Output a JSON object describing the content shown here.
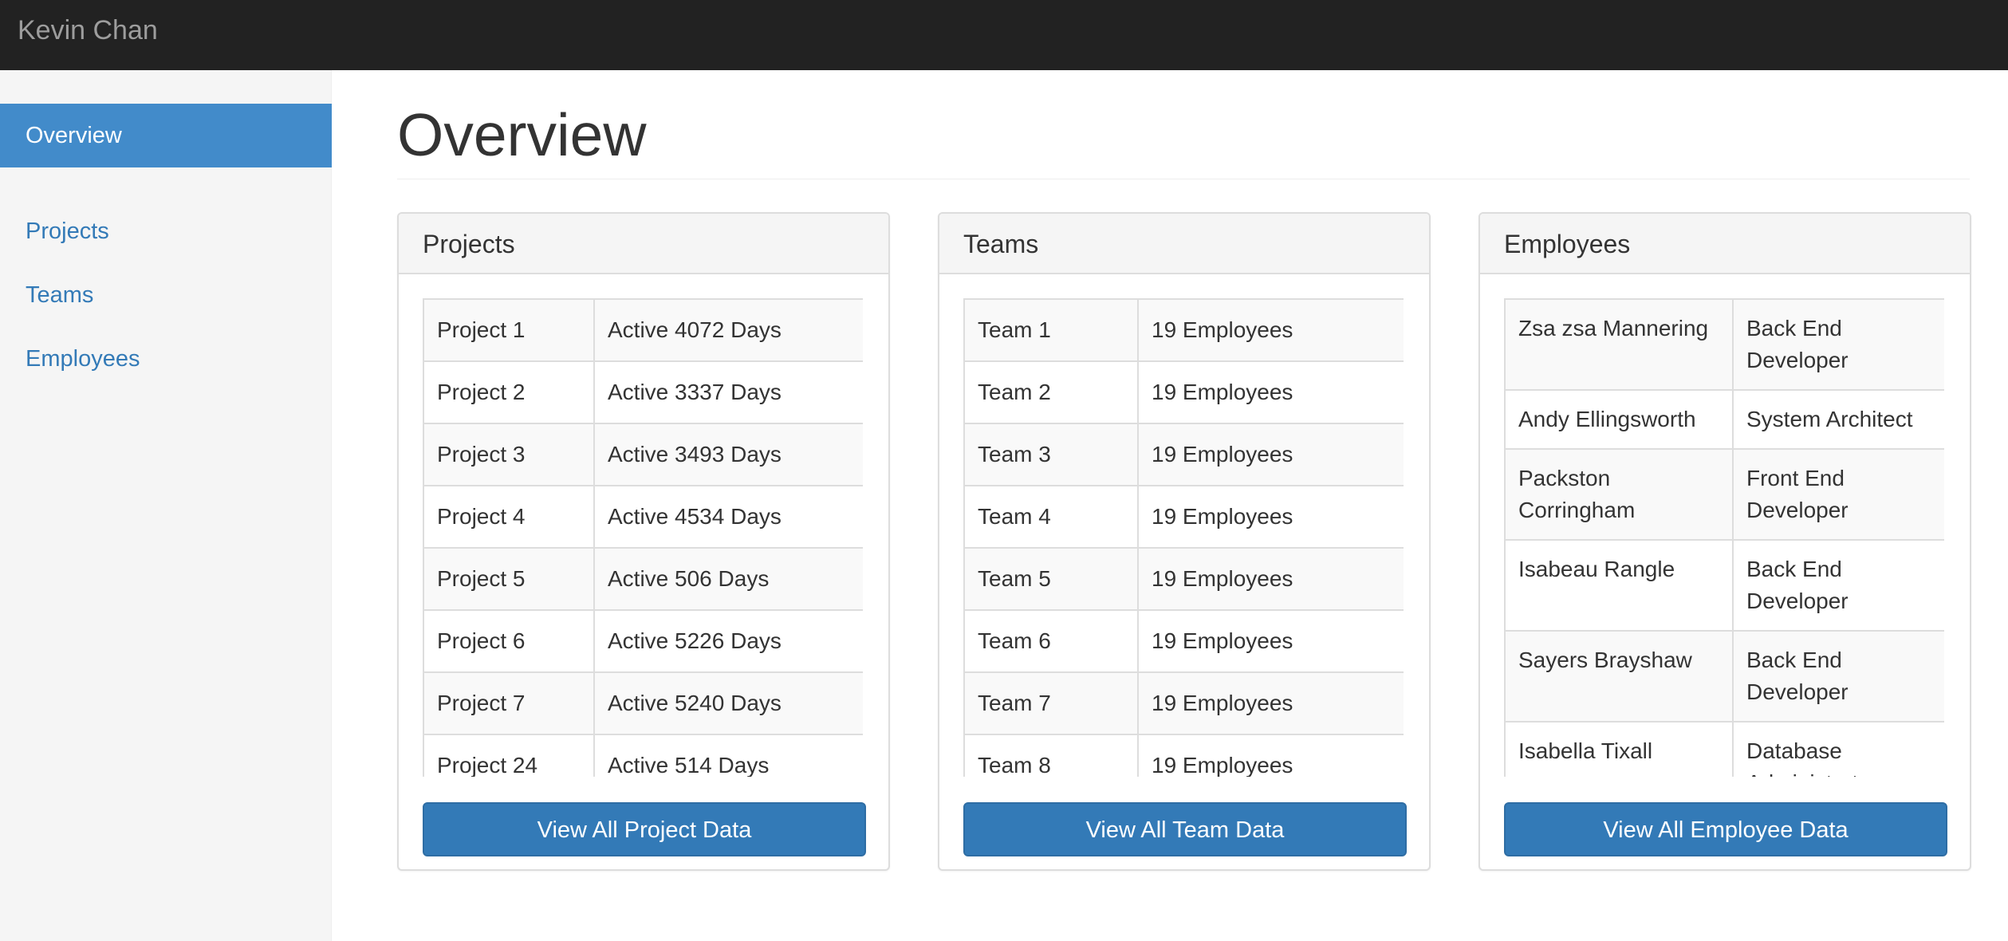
{
  "navbar": {
    "brand": "Kevin Chan"
  },
  "sidebar": {
    "items": [
      {
        "label": "Overview",
        "active": true
      },
      {
        "label": "Projects",
        "active": false
      },
      {
        "label": "Teams",
        "active": false
      },
      {
        "label": "Employees",
        "active": false
      }
    ]
  },
  "main": {
    "title": "Overview",
    "panels": {
      "projects": {
        "title": "Projects",
        "rows": [
          [
            "Project 1",
            "Active 4072 Days"
          ],
          [
            "Project 2",
            "Active 3337 Days"
          ],
          [
            "Project 3",
            "Active 3493 Days"
          ],
          [
            "Project 4",
            "Active 4534 Days"
          ],
          [
            "Project 5",
            "Active 506 Days"
          ],
          [
            "Project 6",
            "Active 5226 Days"
          ],
          [
            "Project 7",
            "Active 5240 Days"
          ],
          [
            "Project 24",
            "Active 514 Days"
          ]
        ],
        "button": "View All Project Data"
      },
      "teams": {
        "title": "Teams",
        "rows": [
          [
            "Team 1",
            "19 Employees"
          ],
          [
            "Team 2",
            "19 Employees"
          ],
          [
            "Team 3",
            "19 Employees"
          ],
          [
            "Team 4",
            "19 Employees"
          ],
          [
            "Team 5",
            "19 Employees"
          ],
          [
            "Team 6",
            "19 Employees"
          ],
          [
            "Team 7",
            "19 Employees"
          ],
          [
            "Team 8",
            "19 Employees"
          ]
        ],
        "button": "View All Team Data"
      },
      "employees": {
        "title": "Employees",
        "rows": [
          [
            "Zsa zsa Mannering",
            "Back End Developer"
          ],
          [
            "Andy Ellingsworth",
            "System Architect"
          ],
          [
            "Packston Corringham",
            "Front End Developer"
          ],
          [
            "Isabeau Rangle",
            "Back End Developer"
          ],
          [
            "Sayers Brayshaw",
            "Back End Developer"
          ],
          [
            "Isabella Tixall",
            "Database Administrator"
          ]
        ],
        "button": "View All Employee Data"
      }
    }
  },
  "colors": {
    "navbar_bg": "#222222",
    "sidebar_active": "#428bca",
    "link": "#337ab7",
    "button_primary": "#337ab7"
  }
}
